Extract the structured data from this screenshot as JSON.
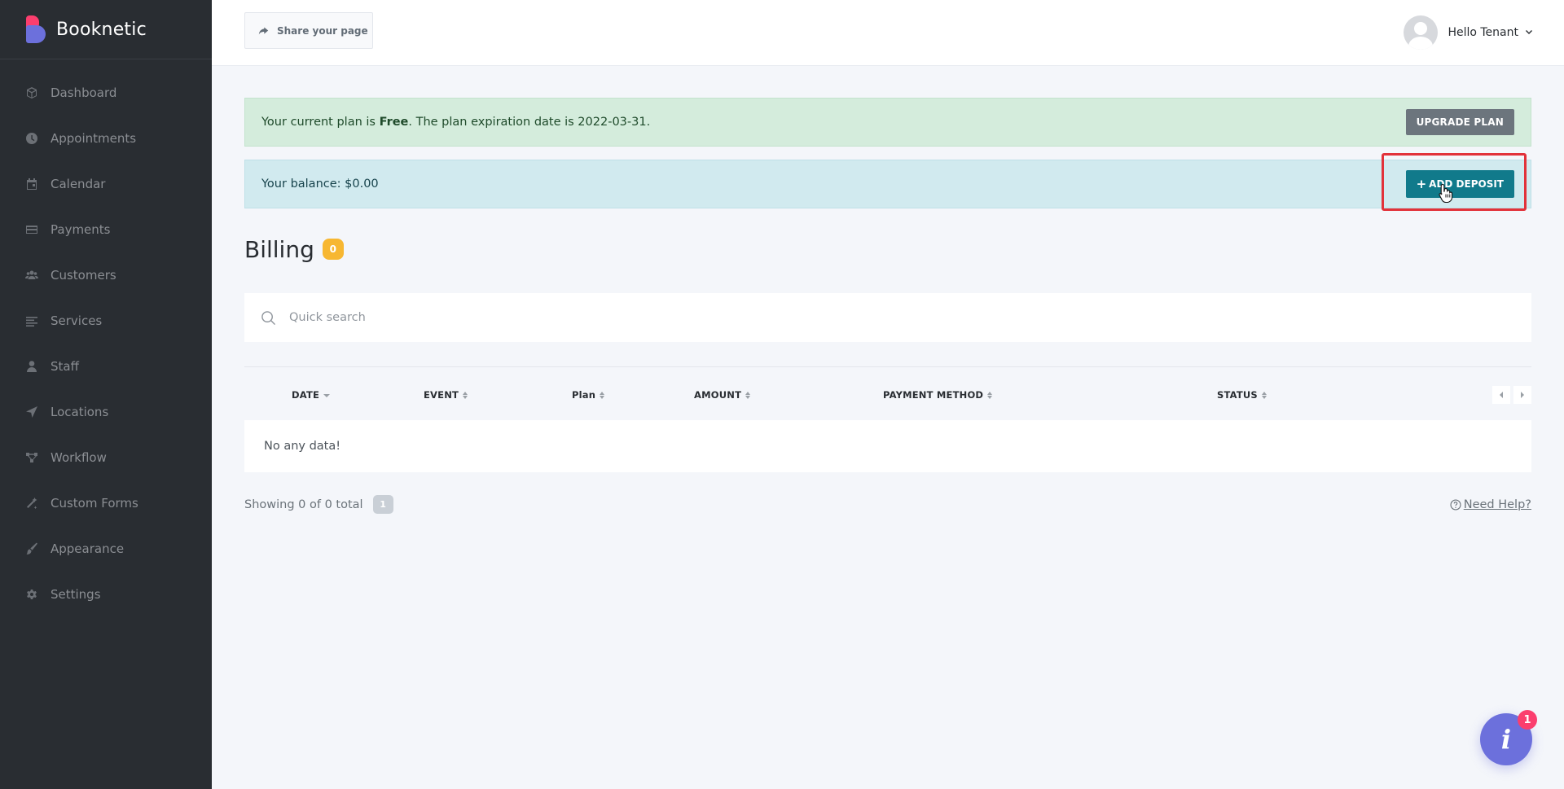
{
  "brand": {
    "name": "Booknetic"
  },
  "sidebar": {
    "items": [
      {
        "label": "Dashboard",
        "icon": "cube-icon"
      },
      {
        "label": "Appointments",
        "icon": "clock-icon"
      },
      {
        "label": "Calendar",
        "icon": "calendar-icon"
      },
      {
        "label": "Payments",
        "icon": "credit-card-icon"
      },
      {
        "label": "Customers",
        "icon": "users-icon"
      },
      {
        "label": "Services",
        "icon": "list-icon"
      },
      {
        "label": "Staff",
        "icon": "user-icon"
      },
      {
        "label": "Locations",
        "icon": "location-arrow-icon"
      },
      {
        "label": "Workflow",
        "icon": "workflow-icon"
      },
      {
        "label": "Custom Forms",
        "icon": "magic-wand-icon"
      },
      {
        "label": "Appearance",
        "icon": "brush-icon"
      },
      {
        "label": "Settings",
        "icon": "gear-icon"
      }
    ]
  },
  "topbar": {
    "share_label": "Share your page",
    "user_greeting": "Hello Tenant"
  },
  "plan_alert": {
    "prefix": "Your current plan is ",
    "plan_name": "Free",
    "suffix": ". The plan expiration date is 2022-03-31.",
    "button_label": "UPGRADE PLAN"
  },
  "balance_alert": {
    "text": "Your balance: $0.00",
    "button_plus": "+",
    "button_label": "ADD DEPOSIT"
  },
  "page": {
    "title": "Billing",
    "count": "0"
  },
  "search": {
    "placeholder": "Quick search"
  },
  "table": {
    "columns": [
      "DATE",
      "EVENT",
      "Plan",
      "AMOUNT",
      "PAYMENT METHOD",
      "STATUS"
    ],
    "empty_text": "No any data!"
  },
  "footer": {
    "showing_text": "Showing 0 of 0 total",
    "page_number": "1",
    "help_label": "Need Help?"
  },
  "info_fab": {
    "glyph": "i",
    "badge": "1"
  },
  "colors": {
    "sidebar_bg": "#292d32",
    "accent": "#6c70dc",
    "brand_pink": "#fb3e6e",
    "plan_alert_bg": "#d4ecdc",
    "balance_alert_bg": "#d1eaef",
    "deposit_button": "#117a8b",
    "upgrade_button": "#6c757d",
    "highlight": "#e2323a",
    "badge_yellow": "#f7b731"
  }
}
